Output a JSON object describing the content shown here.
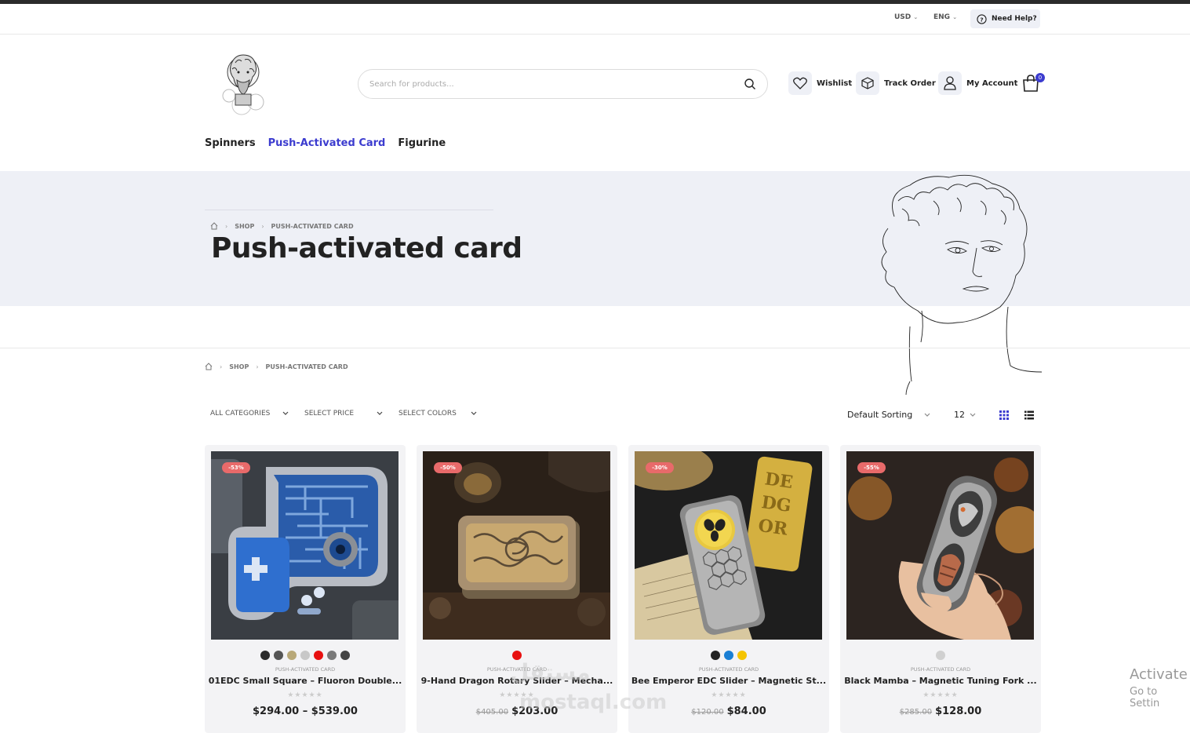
{
  "utility": {
    "currency": "USD",
    "language": "ENG",
    "help_label": "Need Help?"
  },
  "search": {
    "placeholder": "Search for products..."
  },
  "header_actions": {
    "wishlist": "Wishlist",
    "track_order": "Track Order",
    "my_account": "My Account",
    "cart_count": "0"
  },
  "nav": {
    "items": [
      "Spinners",
      "Push-Activated Card",
      "Figurine"
    ],
    "active": "Push-Activated Card"
  },
  "banner": {
    "crumb_shop": "SHOP",
    "crumb_current": "PUSH-ACTIVATED CARD",
    "title": "Push-activated card"
  },
  "breadcrumb": {
    "shop": "SHOP",
    "current": "PUSH-ACTIVATED CARD"
  },
  "filters": {
    "categories": "ALL CATEGORIES",
    "price": "SELECT PRICE",
    "colors": "SELECT COLORS",
    "sorting": "Default Sorting",
    "per_page": "12"
  },
  "products": [
    {
      "badge": "-53%",
      "category": "PUSH-ACTIVATED CARD",
      "name": "01EDC Small Square – Fluoron Double...",
      "old_price": "",
      "price": "$294.00 – $539.00",
      "colors": [
        "#2b2b2b",
        "#555555",
        "#b8a878",
        "#c8c8c8",
        "#e81010",
        "#7a7a7a",
        "#444444"
      ]
    },
    {
      "badge": "-50%",
      "category": "PUSH-ACTIVATED CARD",
      "name": "9-Hand Dragon Rotary Slider – Mecha...",
      "old_price": "$405.00",
      "price": "$203.00",
      "colors": [
        "#e81010"
      ]
    },
    {
      "badge": "-30%",
      "category": "PUSH-ACTIVATED CARD",
      "name": "Bee Emperor EDC Slider – Magnetic St...",
      "old_price": "$120.00",
      "price": "$84.00",
      "colors": [
        "#222222",
        "#1a7fd4",
        "#f5c400"
      ]
    },
    {
      "badge": "-55%",
      "category": "PUSH-ACTIVATED CARD",
      "name": "Black Mamba – Magnetic Tuning Fork ...",
      "old_price": "$285.00",
      "price": "$128.00",
      "colors": [
        "#d0d0d0"
      ]
    }
  ],
  "overlay": {
    "activate_title": "Activate",
    "activate_sub": "Go to Settin",
    "watermark_ar": "مستقل",
    "watermark_en": "mostaql.com"
  },
  "accent_color": "#3c3ccf",
  "sale_color": "#e86a6a"
}
